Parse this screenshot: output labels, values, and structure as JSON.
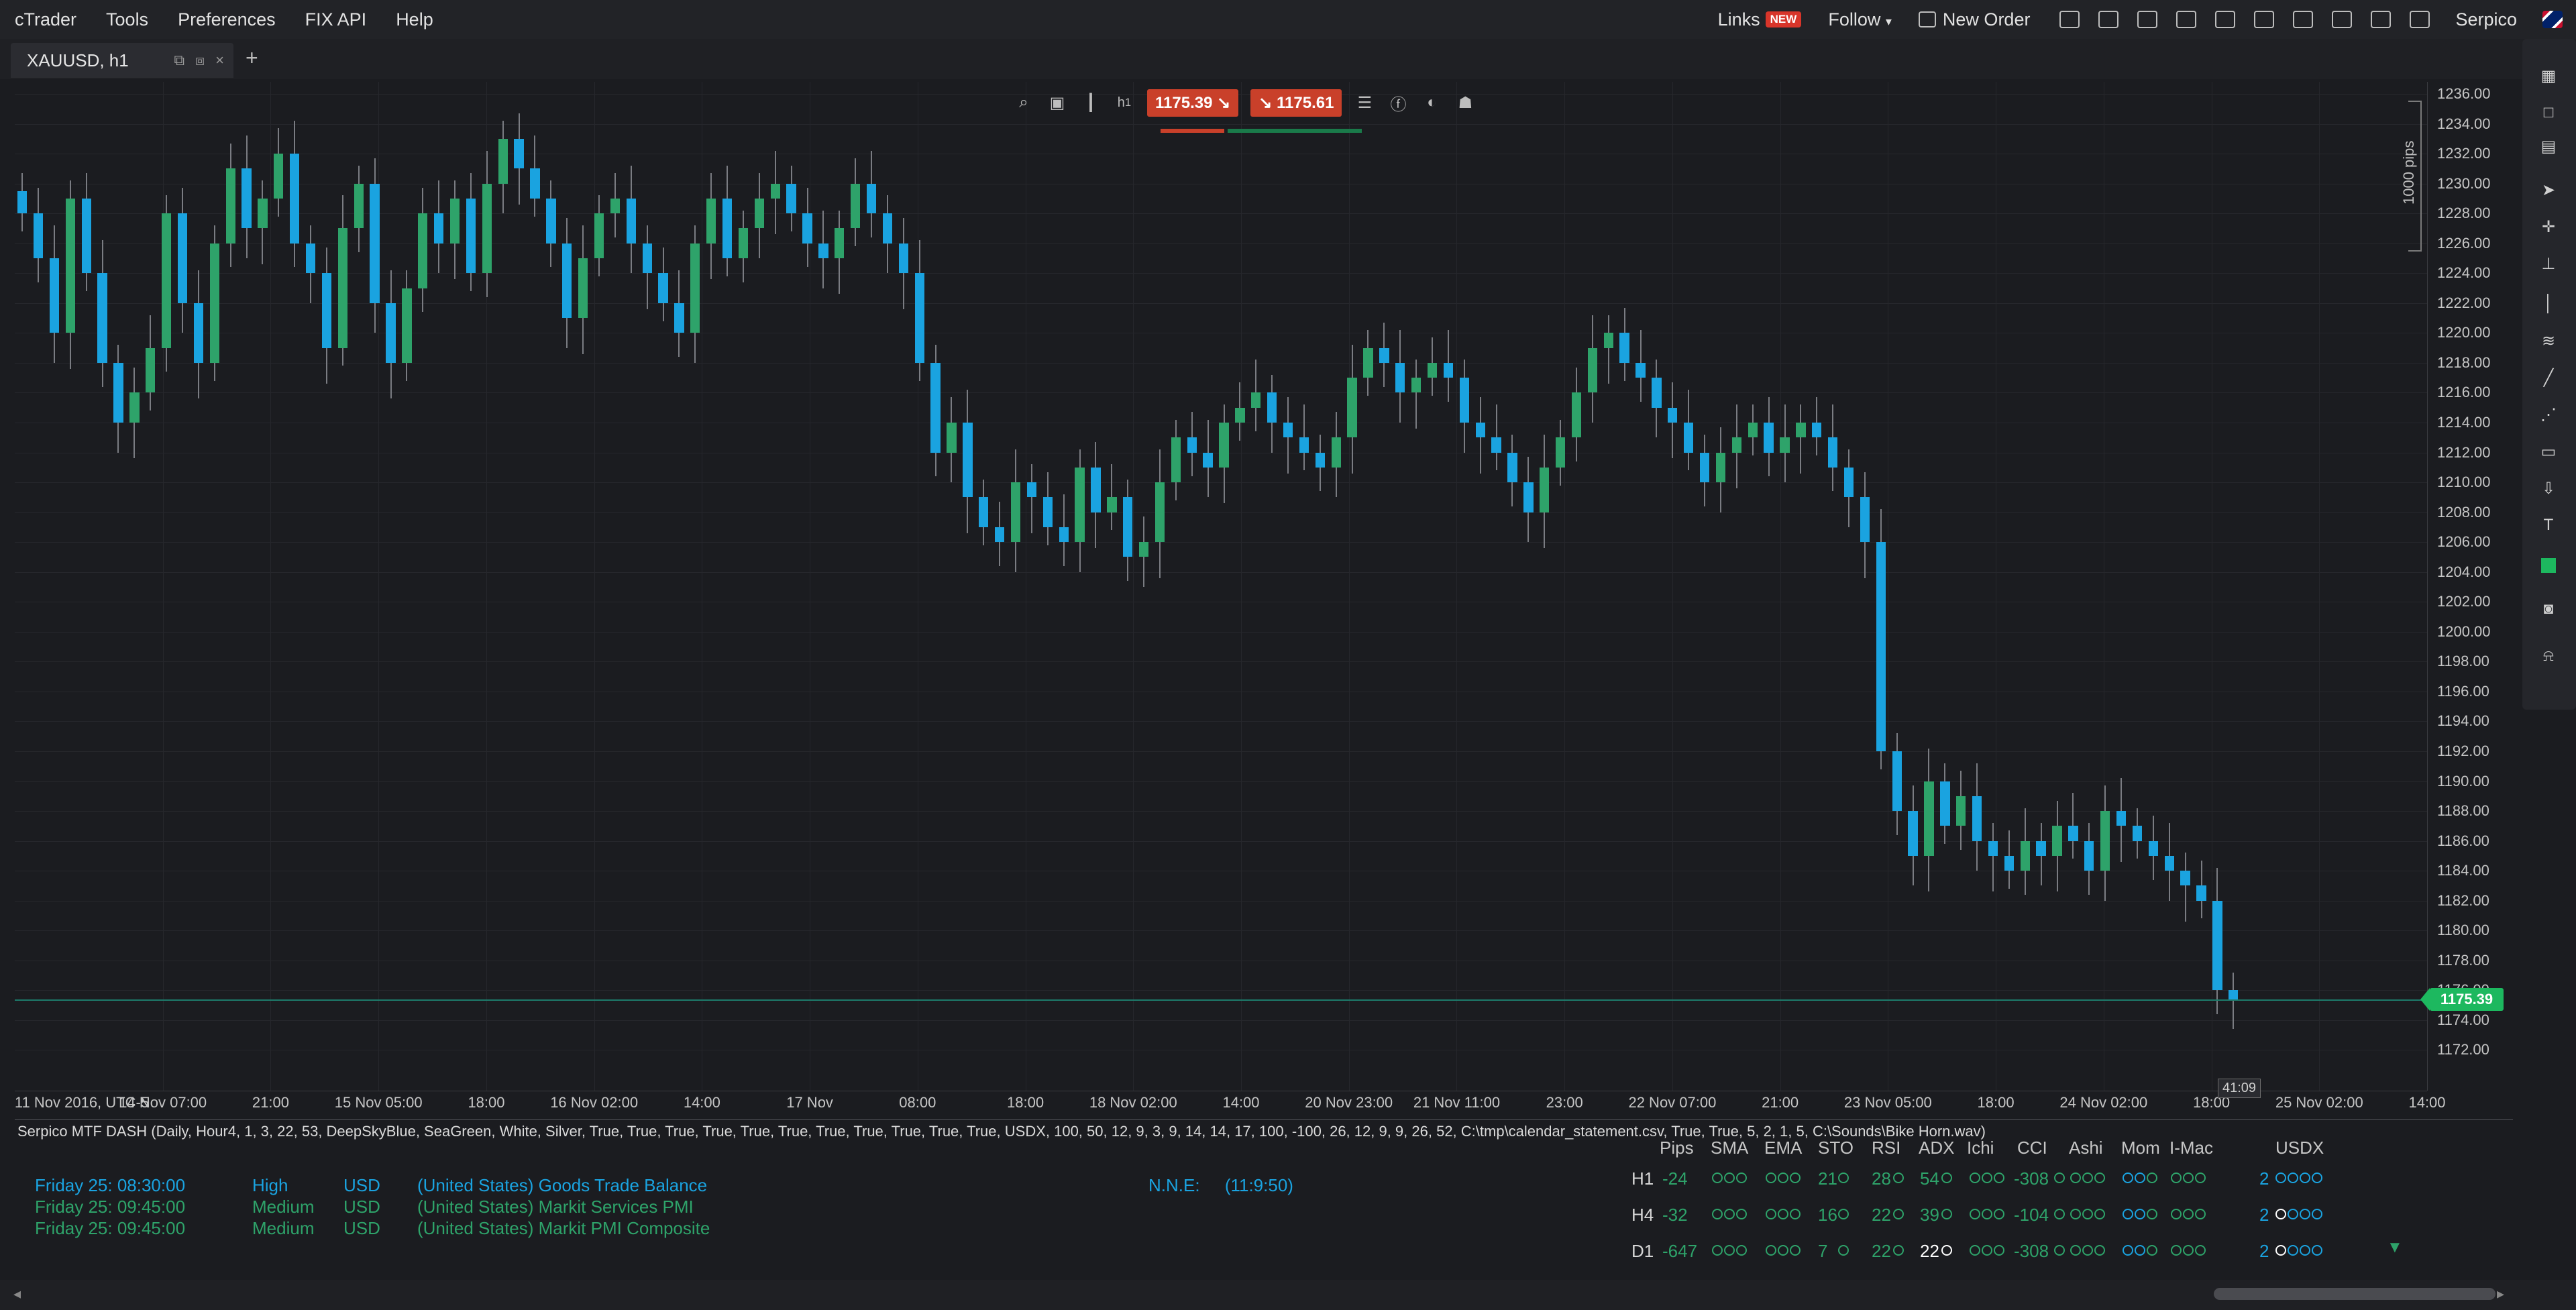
{
  "menubar": {
    "items": [
      "cTrader",
      "Tools",
      "Preferences",
      "FIX API",
      "Help"
    ],
    "links_label": "Links",
    "links_badge": "NEW",
    "follow_label": "Follow",
    "follow_caret": "▾",
    "new_order_label": "New Order",
    "user_label": "Serpico",
    "toolbar_icons": [
      "layout-icon",
      "screen-icon",
      "alert-bell-icon",
      "chart-type-icon",
      "copy-icon",
      "history-icon",
      "mail-icon",
      "sound-icon",
      "window-icon",
      "fullscreen-icon",
      "flag-uk-icon"
    ]
  },
  "tabbar": {
    "tab_label": "XAUUSD, h1",
    "add_label": "+"
  },
  "trade_panel": {
    "sell_price": "1175.39",
    "buy_price": "1175.61",
    "timeframe": "h",
    "timeframe_sub": "1",
    "colors": {
      "sell": "#c9402a",
      "buy": "#c9402a",
      "bull": "#2ea36a",
      "bear": "#1aa3e0"
    }
  },
  "pips_label": "1000 pips",
  "price_tag": "1175.39",
  "countdown": "41:09",
  "chart_data": {
    "type": "candlestick",
    "title": "XAUUSD, h1",
    "ylim": [
      1170.0,
      1236.0
    ],
    "yticks": [
      "1236.00",
      "1234.00",
      "1232.00",
      "1230.00",
      "1228.00",
      "1226.00",
      "1224.00",
      "1222.00",
      "1220.00",
      "1218.00",
      "1216.00",
      "1214.00",
      "1212.00",
      "1210.00",
      "1208.00",
      "1206.00",
      "1204.00",
      "1202.00",
      "1200.00",
      "1198.00",
      "1196.00",
      "1194.00",
      "1192.00",
      "1190.00",
      "1188.00",
      "1186.00",
      "1184.00",
      "1182.00",
      "1180.00",
      "1178.00",
      "1176.00",
      "1174.00",
      "1172.00"
    ],
    "xticks": [
      "11 Nov 2016, UTC-5",
      "14 Nov 07:00",
      "21:00",
      "15 Nov 05:00",
      "18:00",
      "16 Nov 02:00",
      "14:00",
      "17 Nov",
      "08:00",
      "18:00",
      "18 Nov 02:00",
      "14:00",
      "20 Nov 23:00",
      "21 Nov 11:00",
      "23:00",
      "22 Nov 07:00",
      "21:00",
      "23 Nov 05:00",
      "18:00",
      "24 Nov 02:00",
      "18:00",
      "25 Nov 02:00",
      "14:00"
    ],
    "last_price": 1175.39,
    "close": [
      1228,
      1225,
      1220,
      1229,
      1224,
      1218,
      1214,
      1216,
      1219,
      1228,
      1222,
      1218,
      1226,
      1231,
      1227,
      1229,
      1232,
      1226,
      1224,
      1219,
      1227,
      1230,
      1222,
      1218,
      1223,
      1228,
      1226,
      1229,
      1224,
      1230,
      1233,
      1231,
      1229,
      1226,
      1221,
      1225,
      1228,
      1229,
      1226,
      1224,
      1222,
      1220,
      1226,
      1229,
      1225,
      1227,
      1229,
      1230,
      1228,
      1226,
      1225,
      1227,
      1230,
      1228,
      1226,
      1224,
      1218,
      1212,
      1214,
      1209,
      1207,
      1206,
      1210,
      1209,
      1207,
      1206,
      1211,
      1208,
      1209,
      1205,
      1206,
      1210,
      1213,
      1212,
      1211,
      1214,
      1215,
      1216,
      1214,
      1213,
      1212,
      1211,
      1213,
      1217,
      1219,
      1218,
      1216,
      1217,
      1218,
      1217,
      1214,
      1213,
      1212,
      1210,
      1208,
      1211,
      1213,
      1216,
      1219,
      1220,
      1218,
      1217,
      1215,
      1214,
      1212,
      1210,
      1212,
      1213,
      1214,
      1212,
      1213,
      1214,
      1213,
      1211,
      1209,
      1206,
      1192,
      1188,
      1185,
      1190,
      1187,
      1189,
      1186,
      1185,
      1184,
      1186,
      1185,
      1187,
      1186,
      1184,
      1188,
      1187,
      1186,
      1185,
      1184,
      1183,
      1182,
      1176,
      1175.39
    ]
  },
  "indicator_panel": {
    "header": "Serpico MTF DASH (Daily, Hour4, 1, 3, 22, 53, DeepSkyBlue, SeaGreen, White, Silver, True, True, True, True, True, True, True, True, True, True, True, USDX, 100, 50, 12, 9, 3, 9, 14, 14, 17, 100, -100, 26, 12, 9, 9, 26, 52, C:\\tmp\\calendar_statement.csv, True, True, 5, 2, 1, 5, C:\\Sounds\\Bike Horn.wav)",
    "news": [
      {
        "time": "Friday 25: 08:30:00",
        "impact": "High",
        "currency": "USD",
        "event": "(United States) Goods Trade Balance"
      },
      {
        "time": "Friday 25: 09:45:00",
        "impact": "Medium",
        "currency": "USD",
        "event": "(United States) Markit Services PMI"
      },
      {
        "time": "Friday 25: 09:45:00",
        "impact": "Medium",
        "currency": "USD",
        "event": "(United States) Markit PMI Composite"
      }
    ],
    "nne_label": "N.N.E:",
    "nne_value": "(11:9:50)",
    "columns": [
      "Pips",
      "SMA",
      "EMA",
      "STO",
      "RSI",
      "ADX",
      "Ichi",
      "CCI",
      "Ashi",
      "Mom",
      "I-Mac",
      "USDX"
    ],
    "rows": [
      {
        "tf": "H1",
        "pips": "-24",
        "sto": "21",
        "rsi": "28",
        "adx": "54",
        "cci": "-308",
        "usdx": "2"
      },
      {
        "tf": "H4",
        "pips": "-32",
        "sto": "16",
        "rsi": "22",
        "adx": "39",
        "cci": "-104",
        "usdx": "2"
      },
      {
        "tf": "D1",
        "pips": "-647",
        "sto": "7",
        "rsi": "22",
        "adx": "22",
        "cci": "-308",
        "usdx": "2"
      }
    ],
    "arrow": "▼"
  }
}
